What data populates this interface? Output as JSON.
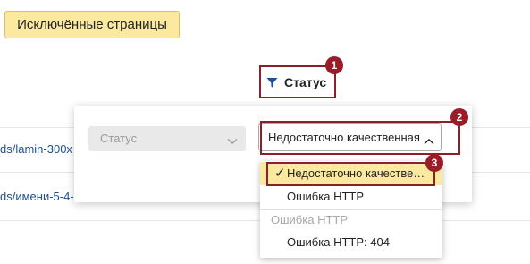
{
  "toolbar": {
    "excluded_pages_label": "Исключённые страницы"
  },
  "table": {
    "rows": [
      {
        "link": "ds/lamin-300x"
      },
      {
        "link": "ds/имени-5-4-"
      }
    ]
  },
  "column_header": {
    "title": "Статус",
    "icon": "funnel-icon"
  },
  "filter_popup": {
    "field_select": {
      "value": "Статус"
    },
    "value_select": {
      "value": "Недостаточно качественная"
    }
  },
  "dropdown": {
    "selected_item": "Недостаточно качестве…",
    "item_http_error": "Ошибка HTTP",
    "group_label": "Ошибка HTTP",
    "item_http_404": "Ошибка HTTP: 404"
  },
  "annotations": {
    "badge_1": "1",
    "badge_2": "2",
    "badge_3": "3"
  },
  "colors": {
    "highlight": "#fbe9a0",
    "annotation": "#9b1c28",
    "link": "#1f4f8f",
    "filter_icon": "#1a4f9c"
  }
}
